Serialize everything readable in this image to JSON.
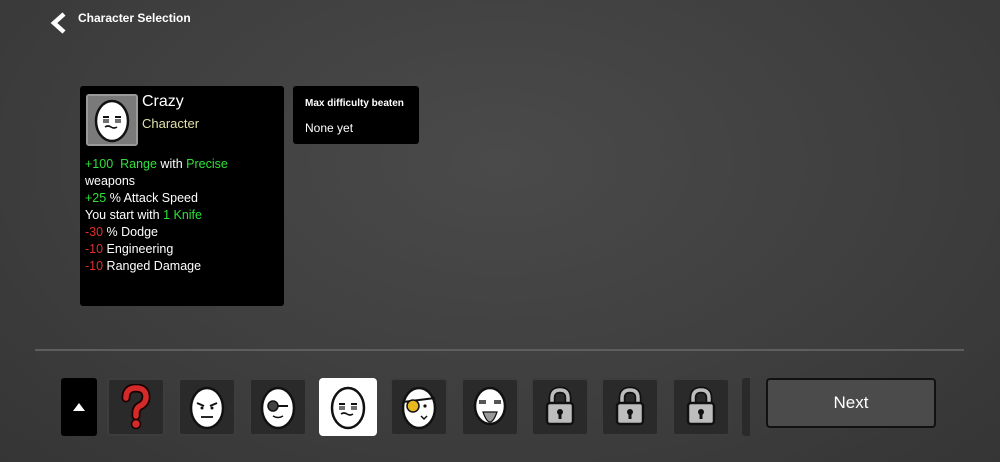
{
  "header": {
    "title": "Character Selection",
    "back_icon": "chevron-left-icon"
  },
  "character": {
    "name": "Crazy",
    "type": "Character",
    "portrait_icon": "egg-crazy-icon",
    "stats": [
      {
        "parts": [
          {
            "t": "+100",
            "c": "g"
          },
          {
            "t": "  "
          },
          {
            "t": "Range",
            "c": "g"
          },
          {
            "t": " with "
          },
          {
            "t": "Precise",
            "c": "g"
          }
        ]
      },
      {
        "parts": [
          {
            "t": "weapons"
          }
        ]
      },
      {
        "parts": [
          {
            "t": "+25",
            "c": "g"
          },
          {
            "t": " % Attack Speed"
          }
        ]
      },
      {
        "parts": [
          {
            "t": "You start with "
          },
          {
            "t": "1 Knife",
            "c": "g"
          }
        ]
      },
      {
        "parts": [
          {
            "t": "-30",
            "c": "r"
          },
          {
            "t": " % Dodge"
          }
        ]
      },
      {
        "parts": [
          {
            "t": "-10",
            "c": "r"
          },
          {
            "t": " Engineering"
          }
        ]
      },
      {
        "parts": [
          {
            "t": "-10",
            "c": "r"
          },
          {
            "t": " Ranged Damage"
          }
        ]
      }
    ]
  },
  "difficulty": {
    "title": "Max difficulty beaten",
    "value": "None yet"
  },
  "roster": {
    "scroll_icon": "triangle-up-icon",
    "slots": [
      {
        "name": "random-character-slot",
        "icon": "question-mark-icon",
        "selected": false
      },
      {
        "name": "character-slot-1",
        "icon": "egg-brawler-icon",
        "selected": false
      },
      {
        "name": "character-slot-2",
        "icon": "egg-goggles-icon",
        "selected": false
      },
      {
        "name": "character-slot-crazy",
        "icon": "egg-crazy-icon",
        "selected": true
      },
      {
        "name": "character-slot-4",
        "icon": "egg-eyepatch-icon",
        "selected": false
      },
      {
        "name": "character-slot-5",
        "icon": "egg-old-bearded-icon",
        "selected": false
      },
      {
        "name": "locked-slot-1",
        "icon": "padlock-icon",
        "selected": false
      },
      {
        "name": "locked-slot-2",
        "icon": "padlock-icon",
        "selected": false
      },
      {
        "name": "locked-slot-3",
        "icon": "padlock-icon",
        "selected": false
      }
    ]
  },
  "footer": {
    "next_label": "Next"
  },
  "colors": {
    "positive": "#2fe03a",
    "negative": "#e0302a",
    "subtitle": "#dfe0a8",
    "selected_slot": "#ffffff"
  }
}
